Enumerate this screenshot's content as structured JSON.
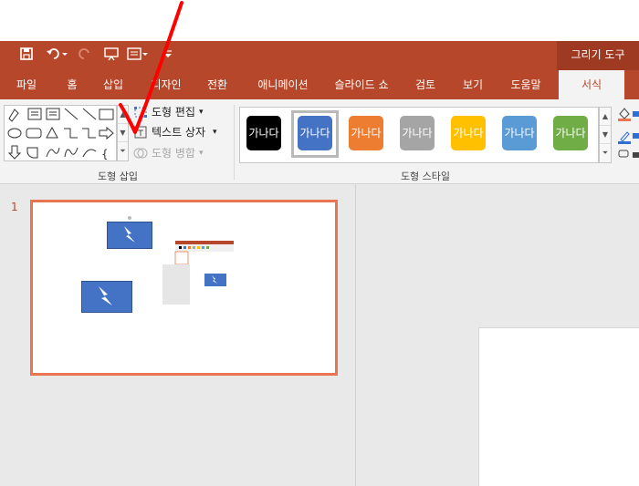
{
  "quick_access": {
    "save_icon": "save-icon",
    "undo_icon": "undo-icon",
    "redo_icon": "redo-icon",
    "present_icon": "present-icon",
    "layout_icon": "layout-icon",
    "customize_icon": "customize-icon"
  },
  "context_tab": "그리기 도구",
  "tabs": [
    "파일",
    "홈",
    "삽입",
    "디자인",
    "전환",
    "애니메이션",
    "슬라이드 쇼",
    "검토",
    "보기",
    "도움말",
    "서식"
  ],
  "active_tab": "서식",
  "insert_shapes": {
    "group_label": "도형 삽입",
    "edit_shape": "도형 편집",
    "text_box": "텍스트 상자",
    "merge_shapes": "도형 병합"
  },
  "shape_styles": {
    "group_label": "도형 스타일",
    "sample_text": "가나다",
    "colors": [
      "#000000",
      "#4472c4",
      "#ed7d31",
      "#a5a5a5",
      "#ffc000",
      "#5b9bd5",
      "#70ad47"
    ],
    "selected_index": 1
  },
  "slides": {
    "number": "1"
  },
  "colors": {
    "brand": "#b7472a",
    "selection": "#e8754f",
    "annotation": "#ff0000"
  }
}
